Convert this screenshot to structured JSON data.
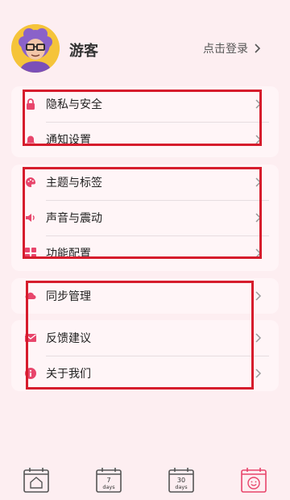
{
  "profile": {
    "username": "游客",
    "login_label": "点击登录"
  },
  "groups": [
    {
      "items": [
        {
          "label": "隐私与安全",
          "icon": "lock-icon"
        },
        {
          "label": "通知设置",
          "icon": "bell-icon"
        }
      ]
    },
    {
      "items": [
        {
          "label": "主题与标签",
          "icon": "palette-icon"
        },
        {
          "label": "声音与震动",
          "icon": "speaker-icon"
        },
        {
          "label": "功能配置",
          "icon": "grid-icon"
        }
      ]
    },
    {
      "items": [
        {
          "label": "同步管理",
          "icon": "cloud-icon"
        }
      ]
    },
    {
      "items": [
        {
          "label": "反馈建议",
          "icon": "mail-icon"
        },
        {
          "label": "关于我们",
          "icon": "info-icon"
        }
      ]
    }
  ],
  "tabbar": [
    {
      "icon": "home-calendar-icon",
      "label": ""
    },
    {
      "icon": "calendar-7-days-icon",
      "number": "7",
      "unit": "days"
    },
    {
      "icon": "calendar-30-days-icon",
      "number": "30",
      "unit": "days"
    },
    {
      "icon": "smiley-calendar-icon",
      "label": "",
      "active": true
    }
  ],
  "colors": {
    "accent": "#e8456b",
    "background": "#fdeef1",
    "card": "#fff5f7",
    "highlight_box": "#d61c2c"
  }
}
